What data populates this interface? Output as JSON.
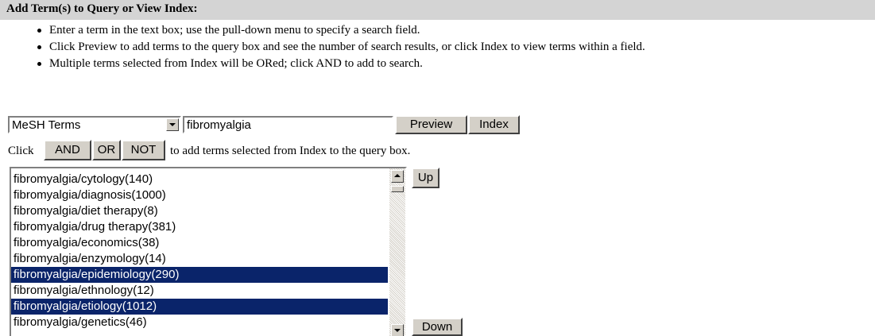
{
  "header": {
    "title": "Add Term(s) to Query or View Index:"
  },
  "instructions": [
    "Enter a term in the text box; use the pull-down menu to specify a search field.",
    "Click Preview to add terms to the query box and see the number of search results, or click Index to view terms within a field.",
    "Multiple terms selected from Index will be ORed; click AND to add to search."
  ],
  "search": {
    "field_select": "MeSH Terms",
    "term_value": "fibromyalgia",
    "preview_label": "Preview",
    "index_label": "Index"
  },
  "combine": {
    "prefix": "Click",
    "and_label": "AND",
    "or_label": "OR",
    "not_label": "NOT",
    "suffix": "to add terms selected from Index to the query box."
  },
  "index_list": {
    "items": [
      {
        "label": "fibromyalgia/cytology(140)",
        "selected": false
      },
      {
        "label": "fibromyalgia/diagnosis(1000)",
        "selected": false
      },
      {
        "label": "fibromyalgia/diet therapy(8)",
        "selected": false
      },
      {
        "label": "fibromyalgia/drug therapy(381)",
        "selected": false
      },
      {
        "label": "fibromyalgia/economics(38)",
        "selected": false
      },
      {
        "label": "fibromyalgia/enzymology(14)",
        "selected": false
      },
      {
        "label": "fibromyalgia/epidemiology(290)",
        "selected": true
      },
      {
        "label": "fibromyalgia/ethnology(12)",
        "selected": false
      },
      {
        "label": "fibromyalgia/etiology(1012)",
        "selected": true
      },
      {
        "label": "fibromyalgia/genetics(46)",
        "selected": false
      }
    ],
    "up_label": "Up",
    "down_label": "Down"
  },
  "colors": {
    "selection": "#0a246a",
    "header_bg": "#d4d4d4",
    "button_face": "#d4d0c8"
  }
}
